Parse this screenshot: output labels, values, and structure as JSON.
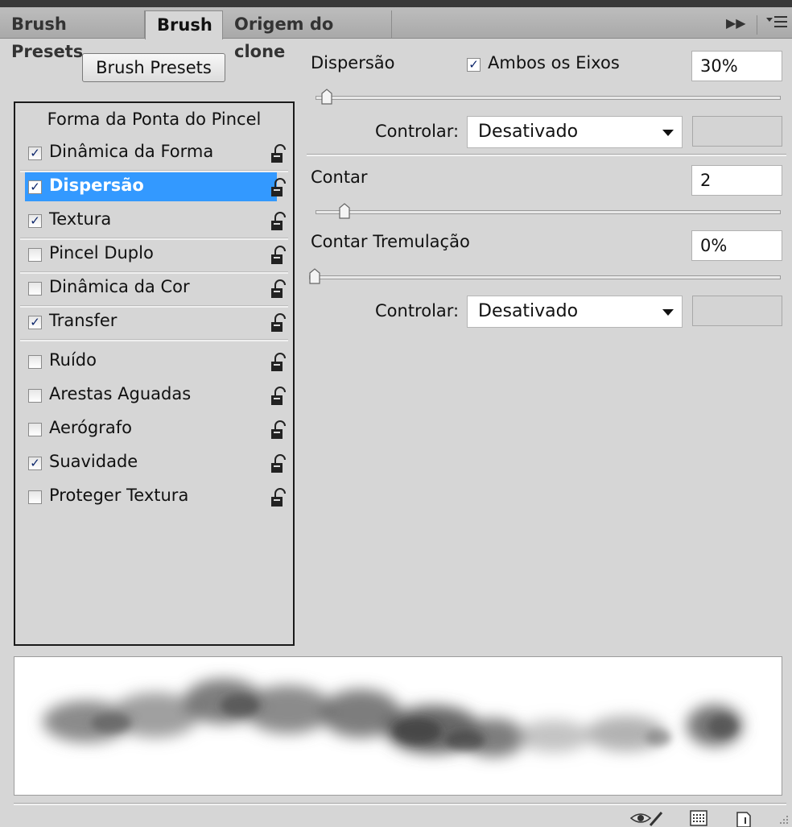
{
  "tabs": [
    {
      "label": "Brush Presets",
      "active": false
    },
    {
      "label": "Brush",
      "active": true
    },
    {
      "label": "Origem do clone",
      "active": false
    }
  ],
  "tab_controls": {
    "collapse_icon": "double-arrow-right-icon",
    "menu_icon": "panel-menu-icon"
  },
  "presets_button": "Brush Presets",
  "list": {
    "header": "Forma da Ponta do Pincel",
    "items": [
      {
        "label": "Dinâmica da Forma",
        "checked": true,
        "selected": false
      },
      {
        "label": "Dispersão",
        "checked": true,
        "selected": true
      },
      {
        "label": "Textura",
        "checked": true,
        "selected": false
      },
      {
        "label": "Pincel Duplo",
        "checked": false,
        "selected": false
      },
      {
        "label": "Dinâmica da Cor",
        "checked": false,
        "selected": false
      },
      {
        "label": "Transfer",
        "checked": true,
        "selected": false
      },
      {
        "label": "Ruído",
        "checked": false,
        "selected": false
      },
      {
        "label": "Arestas Aguadas",
        "checked": false,
        "selected": false
      },
      {
        "label": "Aerógrafo",
        "checked": false,
        "selected": false
      },
      {
        "label": "Suavidade",
        "checked": true,
        "selected": false
      },
      {
        "label": "Proteger Textura",
        "checked": false,
        "selected": false
      }
    ]
  },
  "scatter": {
    "label": "Dispersão",
    "both_axes_label": "Ambos os Eixos",
    "both_axes_checked": true,
    "value": "30%",
    "control_label": "Controlar:",
    "control_value": "Desativado"
  },
  "count": {
    "label": "Contar",
    "value": "2"
  },
  "count_jitter": {
    "label": "Contar Tremulação",
    "value": "0%",
    "control_label": "Controlar:",
    "control_value": "Desativado"
  },
  "check_glyph": "✓",
  "colors": {
    "selection": "#3399ff",
    "panel": "#d6d6d6",
    "check": "#0a246a"
  }
}
